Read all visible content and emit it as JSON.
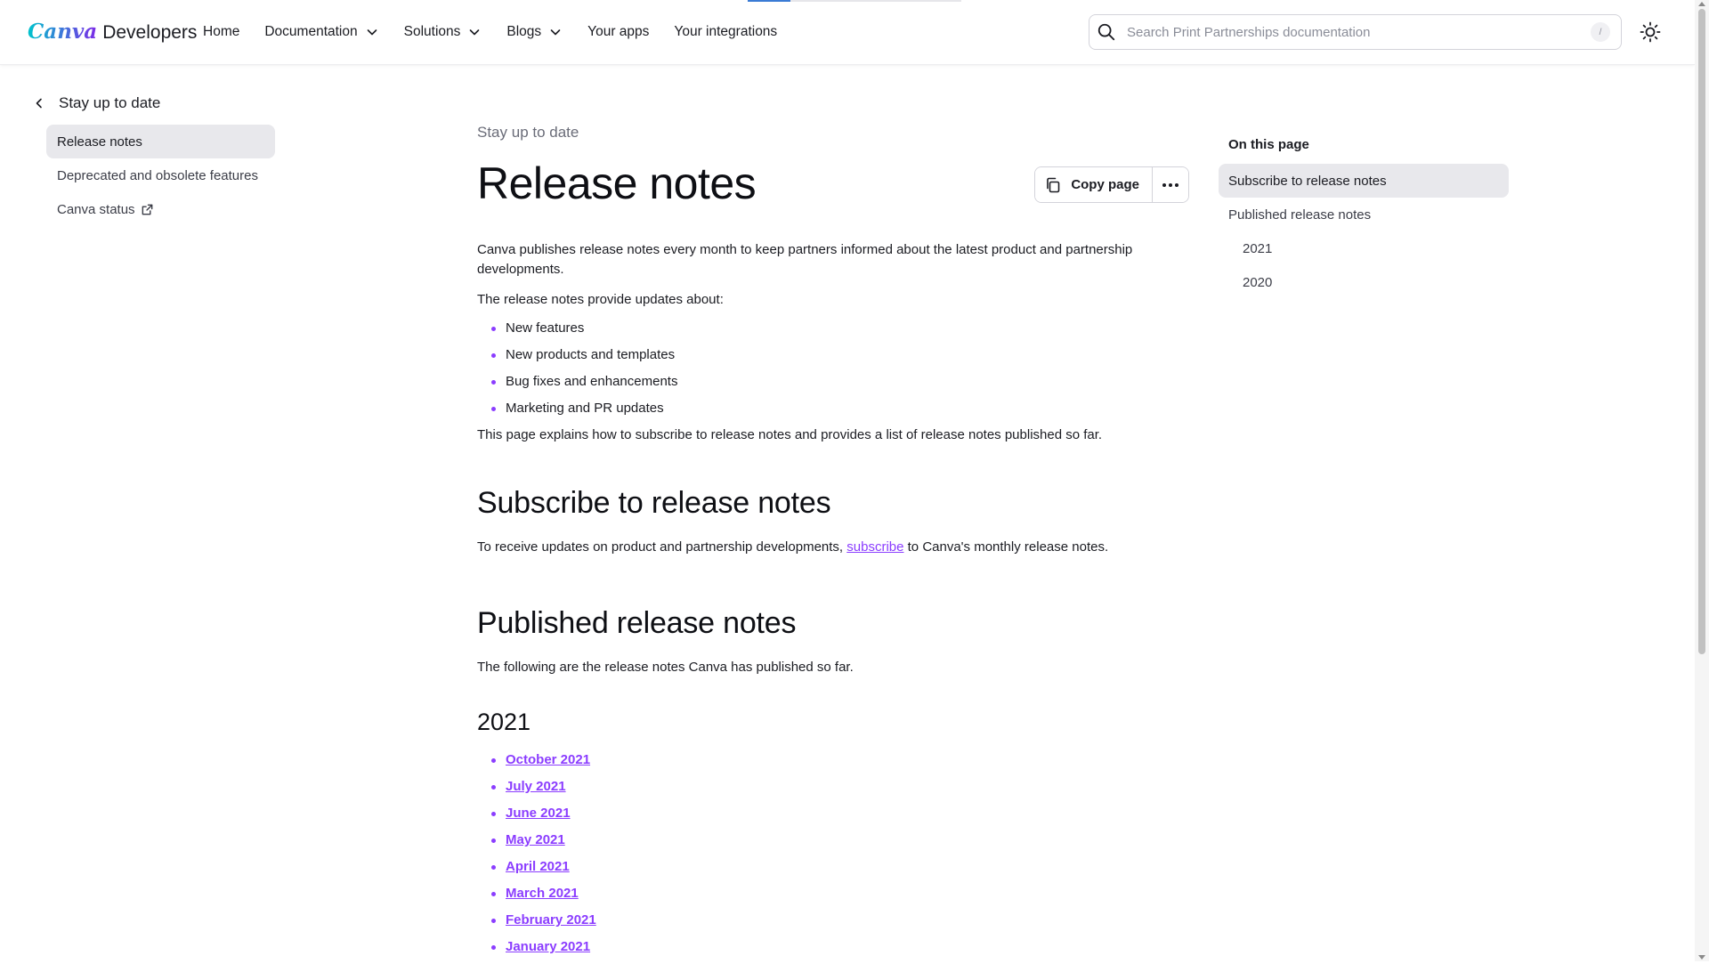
{
  "header": {
    "logo_script": "Canva",
    "logo_word": "Developers",
    "nav": [
      {
        "label": "Home",
        "dropdown": false
      },
      {
        "label": "Documentation",
        "dropdown": true
      },
      {
        "label": "Solutions",
        "dropdown": true
      },
      {
        "label": "Blogs",
        "dropdown": true
      },
      {
        "label": "Your apps",
        "dropdown": false
      },
      {
        "label": "Your integrations",
        "dropdown": false
      }
    ],
    "search": {
      "placeholder": "Search Print Partnerships documentation",
      "shortcut": "/"
    },
    "progress": 0.2
  },
  "sidebar": {
    "back_label": "Stay up to date",
    "items": [
      {
        "label": "Release notes",
        "active": true
      },
      {
        "label": "Deprecated and obsolete features",
        "active": false
      },
      {
        "label": "Canva status",
        "active": false,
        "external": true
      }
    ]
  },
  "main": {
    "breadcrumb": "Stay up to date",
    "title": "Release notes",
    "copy_button": "Copy page",
    "intro": "Canva publishes release notes every month to keep partners informed about the latest product and partnership developments.",
    "updates_intro": "The release notes provide updates about:",
    "updates": [
      "New features",
      "New products and templates",
      "Bug fixes and enhancements",
      "Marketing and PR updates"
    ],
    "outro": "This page explains how to subscribe to release notes and provides a list of release notes published so far.",
    "subscribe": {
      "heading": "Subscribe to release notes",
      "text_before": "To receive updates on product and partnership developments, ",
      "link": "subscribe",
      "text_after": " to Canva's monthly release notes."
    },
    "published": {
      "heading": "Published release notes",
      "text": "The following are the release notes Canva has published so far.",
      "year": "2021",
      "links": [
        "October 2021",
        "July 2021",
        "June 2021",
        "May 2021",
        "April 2021",
        "March 2021",
        "February 2021",
        "January 2021"
      ]
    }
  },
  "toc": {
    "heading": "On this page",
    "items": [
      {
        "label": "Subscribe to release notes",
        "active": true,
        "sub": false
      },
      {
        "label": "Published release notes",
        "active": false,
        "sub": false
      },
      {
        "label": "2021",
        "active": false,
        "sub": true
      },
      {
        "label": "2020",
        "active": false,
        "sub": true
      }
    ]
  },
  "colors": {
    "accent": "#8b3dff",
    "active_bg": "#e8e8ec",
    "progress": "#3a7bd5"
  }
}
